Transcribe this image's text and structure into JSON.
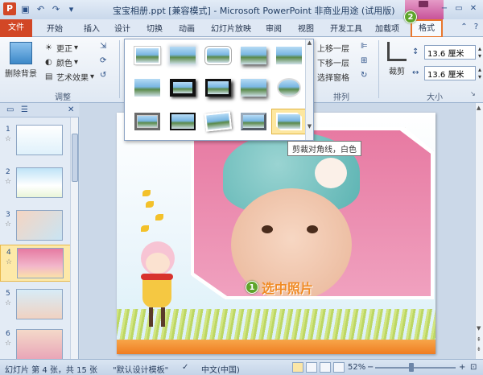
{
  "window": {
    "title": "宝宝相册.ppt [兼容模式] - Microsoft PowerPoint 非商业用途 (试用版)",
    "app_icon": "P"
  },
  "tabs": {
    "file": "文件",
    "items": [
      "开始",
      "插入",
      "设计",
      "切换",
      "动画",
      "幻灯片放映",
      "审阅",
      "视图",
      "开发工具",
      "加载项"
    ],
    "active": "格式"
  },
  "ribbon": {
    "remove_bg": "删除背景",
    "correct": "更正",
    "color": "颜色",
    "artistic": "艺术效果",
    "adjust_caption": "调整",
    "bring_forward": "上移一层",
    "send_backward": "下移一层",
    "selection_pane": "选择窗格",
    "arrange_caption": "排列",
    "crop": "裁剪",
    "height": "13.6 厘米",
    "width": "13.6 厘米",
    "size_caption": "大小"
  },
  "gallery": {
    "styles": [
      "simple-frame-white",
      "soft-edge",
      "rounded-white",
      "drop-shadow",
      "reflected",
      "reflected-bevel",
      "metal-frame",
      "thick-matte-black",
      "simple-frame-black",
      "oval",
      "compound-frame-black",
      "center-shadow",
      "soft-edge-rectangle",
      "bevel-rectangle",
      "snip-diagonal-corner-white"
    ],
    "selected_index": 14,
    "tooltip": "剪裁对角线，白色"
  },
  "slides": [
    {
      "num": "1"
    },
    {
      "num": "2"
    },
    {
      "num": "3"
    },
    {
      "num": "4"
    },
    {
      "num": "5"
    },
    {
      "num": "6"
    }
  ],
  "active_slide": 4,
  "annotations": {
    "step1_num": "1",
    "step1_label": "选中照片",
    "step2_num": "2"
  },
  "status": {
    "slide_info": "幻灯片 第 4 张，共 15 张",
    "theme": "\"默认设计模板\"",
    "language": "中文(中国)",
    "zoom": "52%"
  },
  "colors": {
    "file_tab": "#d24726",
    "highlight": "#e8762c",
    "badge": "#5ea52b",
    "label_text": "#f08a24"
  }
}
